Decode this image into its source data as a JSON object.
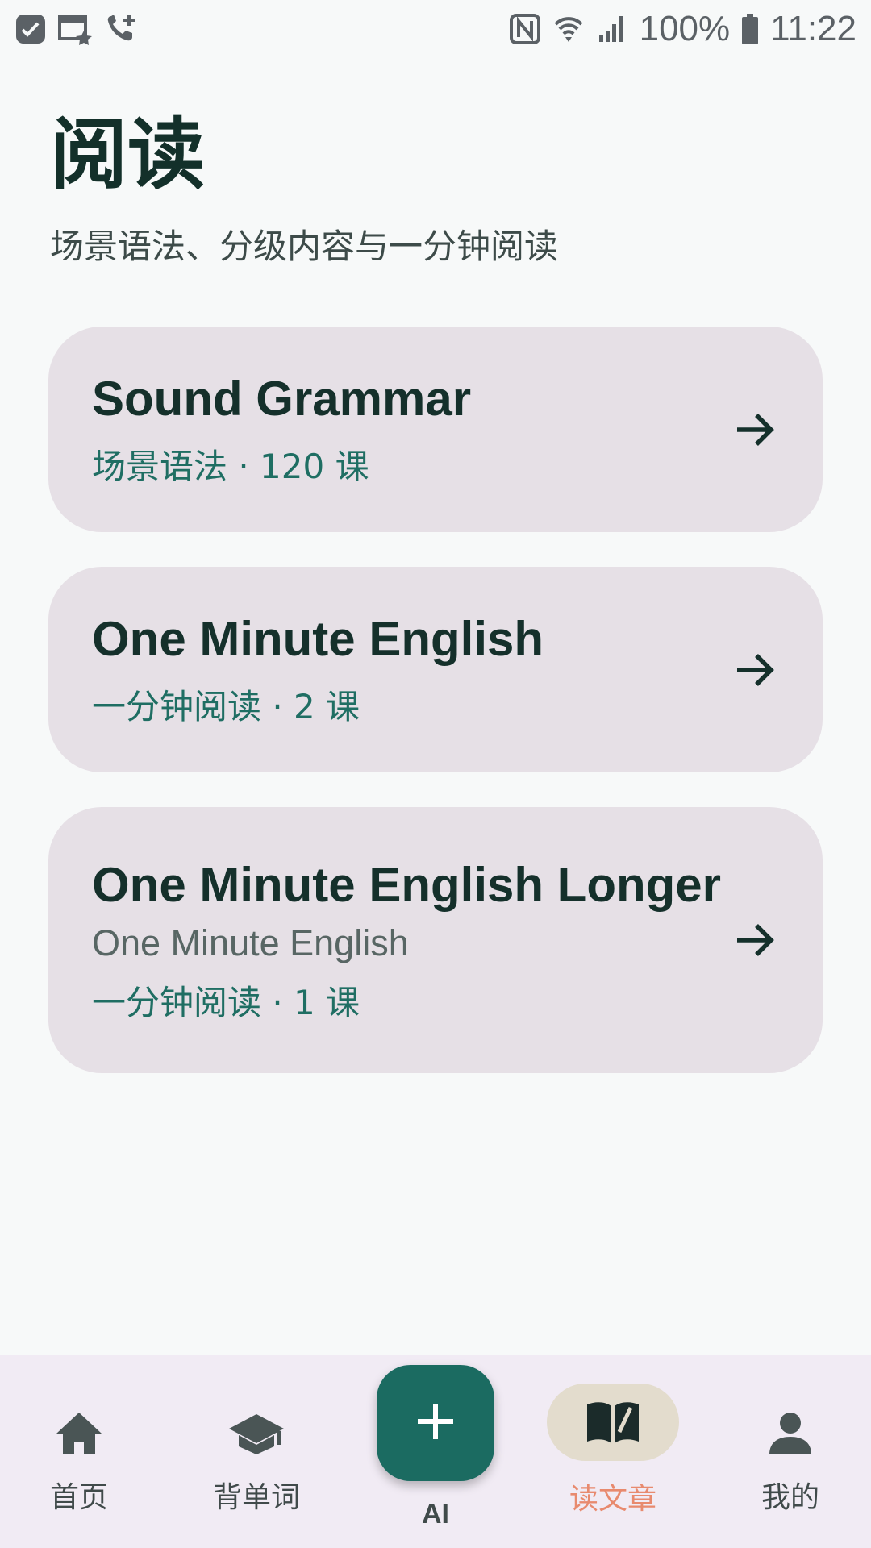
{
  "status_bar": {
    "battery": "100%",
    "time": "11:22"
  },
  "header": {
    "title": "阅读",
    "subtitle": "场景语法、分级内容与一分钟阅读"
  },
  "cards": [
    {
      "title": "Sound Grammar",
      "meta": "场景语法 · 120 课"
    },
    {
      "title": "One Minute English",
      "meta": "一分钟阅读 · 2 课"
    },
    {
      "title": "One Minute English Longer",
      "subtitle": "One Minute English",
      "meta": "一分钟阅读 · 1 课"
    }
  ],
  "bottom_nav": {
    "items": [
      {
        "label": "首页",
        "icon": "home-icon"
      },
      {
        "label": "背单词",
        "icon": "graduation-cap-icon"
      },
      {
        "label": "AI",
        "icon": "plus-icon"
      },
      {
        "label": "读文章",
        "icon": "book-icon",
        "active": true
      },
      {
        "label": "我的",
        "icon": "person-icon"
      }
    ],
    "active_color": "#e88a6e",
    "fab_color": "#1b6b61"
  }
}
